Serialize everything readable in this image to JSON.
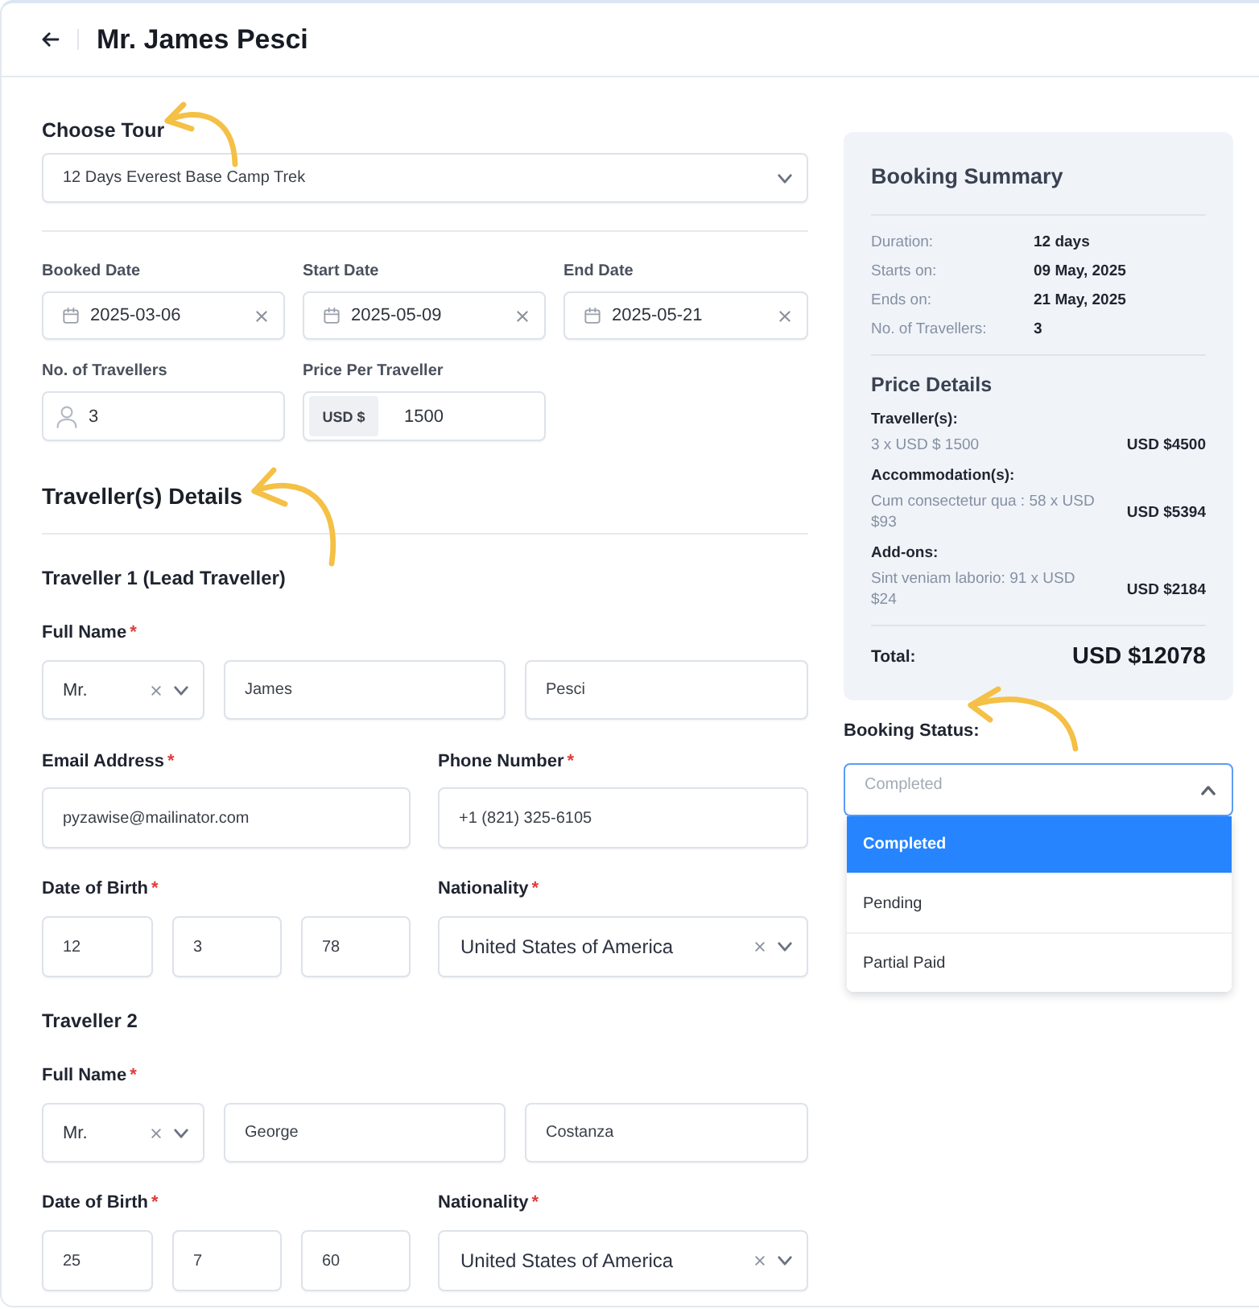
{
  "header": {
    "title": "Mr. James Pesci"
  },
  "tour": {
    "label": "Choose Tour",
    "value": "12 Days Everest Base Camp Trek"
  },
  "trip_fields": [
    {
      "kind": "date",
      "label": "Booked Date",
      "value": "2025-03-06"
    },
    {
      "kind": "date",
      "label": "Start Date",
      "value": "2025-05-09"
    },
    {
      "kind": "date",
      "label": "End Date",
      "value": "2025-05-21"
    },
    {
      "kind": "count",
      "label": "No. of Travellers",
      "value": "3"
    },
    {
      "kind": "price",
      "label": "Price Per Traveller",
      "prefix": "USD $",
      "value": "1500"
    }
  ],
  "travellers_section": {
    "title": "Traveller(s) Details"
  },
  "travellers": [
    {
      "title": "Traveller 1 (Lead Traveller)",
      "full_name": {
        "label": "Full Name",
        "mark": "*",
        "salutation": "Mr.",
        "first_name": "James",
        "last_name": "Pesci"
      },
      "contact": [
        {
          "label": "Email Address",
          "mark": "*",
          "value": "pyzawise@mailinator.com"
        },
        {
          "label": "Phone Number",
          "mark": "*",
          "value": "+1 (821) 325-6105"
        }
      ],
      "birth_date": {
        "label": "Date of Birth",
        "mark": "*",
        "day": "12",
        "month": "3",
        "year": "78"
      },
      "nationality": {
        "label": "Nationality",
        "mark": "*",
        "value": "United States of America"
      }
    },
    {
      "title": "Traveller 2",
      "full_name": {
        "label": "Full Name",
        "mark": "*",
        "salutation": "Mr.",
        "first_name": "George",
        "last_name": "Costanza"
      },
      "birth_date": {
        "label": "Date of Birth",
        "mark": "*",
        "day": "25",
        "month": "7",
        "year": "60"
      },
      "nationality": {
        "label": "Nationality",
        "mark": "*",
        "value": "United States of America"
      }
    }
  ],
  "summary": {
    "title": "Booking Summary",
    "facts": [
      {
        "label": "Duration:",
        "value": "12 days"
      },
      {
        "label": "Starts on:",
        "value": "09 May, 2025"
      },
      {
        "label": "Ends on:",
        "value": "21 May, 2025"
      },
      {
        "label": "No. of Travellers:",
        "value": "3"
      }
    ],
    "price_title": "Price Details",
    "price_groups": [
      {
        "title": "Traveller(s):",
        "detail": "3 x USD $ 1500",
        "amount": "USD $4500"
      },
      {
        "title": "Accommodation(s):",
        "detail": "Cum consectetur qua : 58 x USD $93",
        "amount": "USD $5394"
      },
      {
        "title": "Add-ons:",
        "detail": "Sint veniam laborio: 91 x USD $24",
        "amount": "USD $2184"
      }
    ],
    "total": {
      "label": "Total:",
      "value": "USD $12078"
    }
  },
  "booking_status": {
    "label": "Booking Status:",
    "value": "Completed",
    "expanded": true,
    "options": [
      {
        "label": "Completed",
        "selected": true
      },
      {
        "label": "Pending",
        "selected": false
      },
      {
        "label": "Partial Paid",
        "selected": false
      }
    ]
  }
}
